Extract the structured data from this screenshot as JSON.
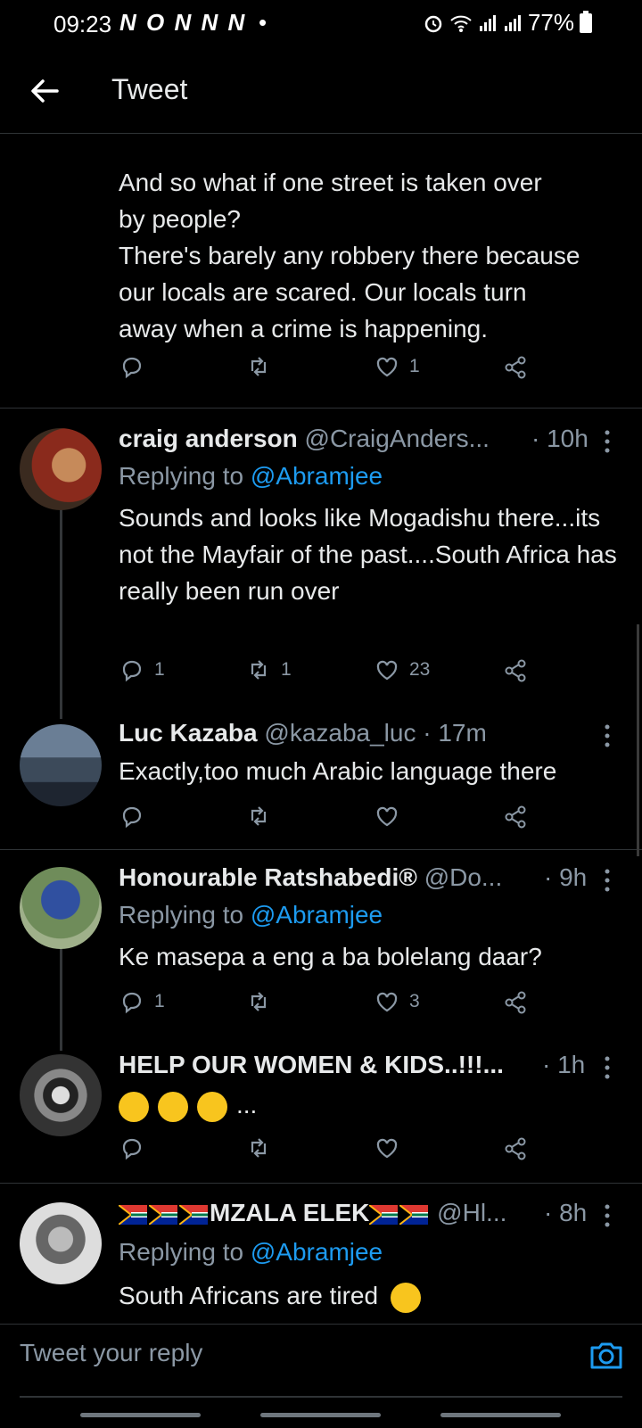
{
  "status": {
    "time": "09:23",
    "notif_icons": "N O N N N",
    "notif_dot": "•",
    "battery": "77%"
  },
  "header": {
    "title": "Tweet"
  },
  "main_tweet": {
    "text": "And so what if one street is taken over\nby people?\nThere's barely any robbery there because\nour locals are scared. Our locals turn\naway when a crime is happening.",
    "like_count": "1"
  },
  "replies": [
    {
      "name": "craig anderson",
      "handle": "@CraigAnders...",
      "time": "· 10h",
      "replying_prefix": "Replying to",
      "replying_to": "@Abramjee",
      "text": "Sounds and looks like Mogadishu there...its not the Mayfair of the past....South Africa has really been run over",
      "reply_count": "1",
      "retweet_count": "1",
      "like_count": "23"
    },
    {
      "name": "Luc Kazaba",
      "handle": "@kazaba_luc",
      "time": "· 17m",
      "text": "Exactly,too much Arabic language there"
    },
    {
      "name": "Honourable Ratshabedi®",
      "handle": "@Do...",
      "time": "· 9h",
      "replying_prefix": "Replying to",
      "replying_to": "@Abramjee",
      "text": "Ke masepa a eng a ba bolelang daar?",
      "reply_count": "1",
      "like_count": "3"
    },
    {
      "name": "HELP OUR WOMEN & KIDS..!!!...",
      "time": "· 1h",
      "text_suffix": "..."
    },
    {
      "name": "MZALA ELEK",
      "handle": "@Hl...",
      "time": "· 8h",
      "replying_prefix": "Replying to",
      "replying_to": "@Abramjee",
      "text": "South Africans are tired"
    }
  ],
  "compose": {
    "placeholder": "Tweet your reply"
  },
  "colors": {
    "accent": "#1d9bf0",
    "muted": "#8b98a5",
    "bg": "#000000",
    "text": "#e7e9ea"
  }
}
